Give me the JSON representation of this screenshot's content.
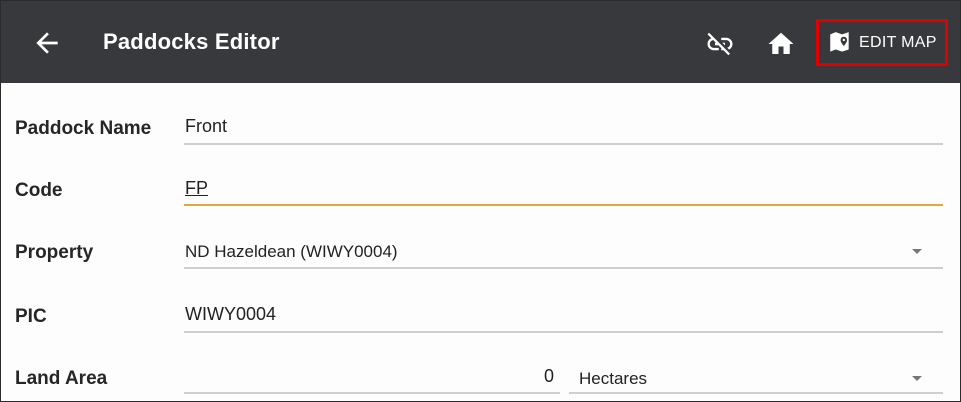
{
  "header": {
    "title": "Paddocks Editor",
    "back_icon": "arrow-left-icon",
    "unlink_icon": "link-off-icon",
    "home_icon": "home-icon",
    "edit_map_icon": "map-marker-icon",
    "edit_map_label": "EDIT MAP",
    "background": "#37393c",
    "highlight_color": "#e00000"
  },
  "form": {
    "paddock_name": {
      "label": "Paddock Name",
      "value": "Front"
    },
    "code": {
      "label": "Code",
      "value": "FP",
      "focus_color": "#e8a33d"
    },
    "property": {
      "label": "Property",
      "value": "ND Hazeldean (WIWY0004)"
    },
    "pic": {
      "label": "PIC",
      "value": "WIWY0004"
    },
    "land_area": {
      "label": "Land Area",
      "value": "0",
      "unit": "Hectares"
    }
  }
}
